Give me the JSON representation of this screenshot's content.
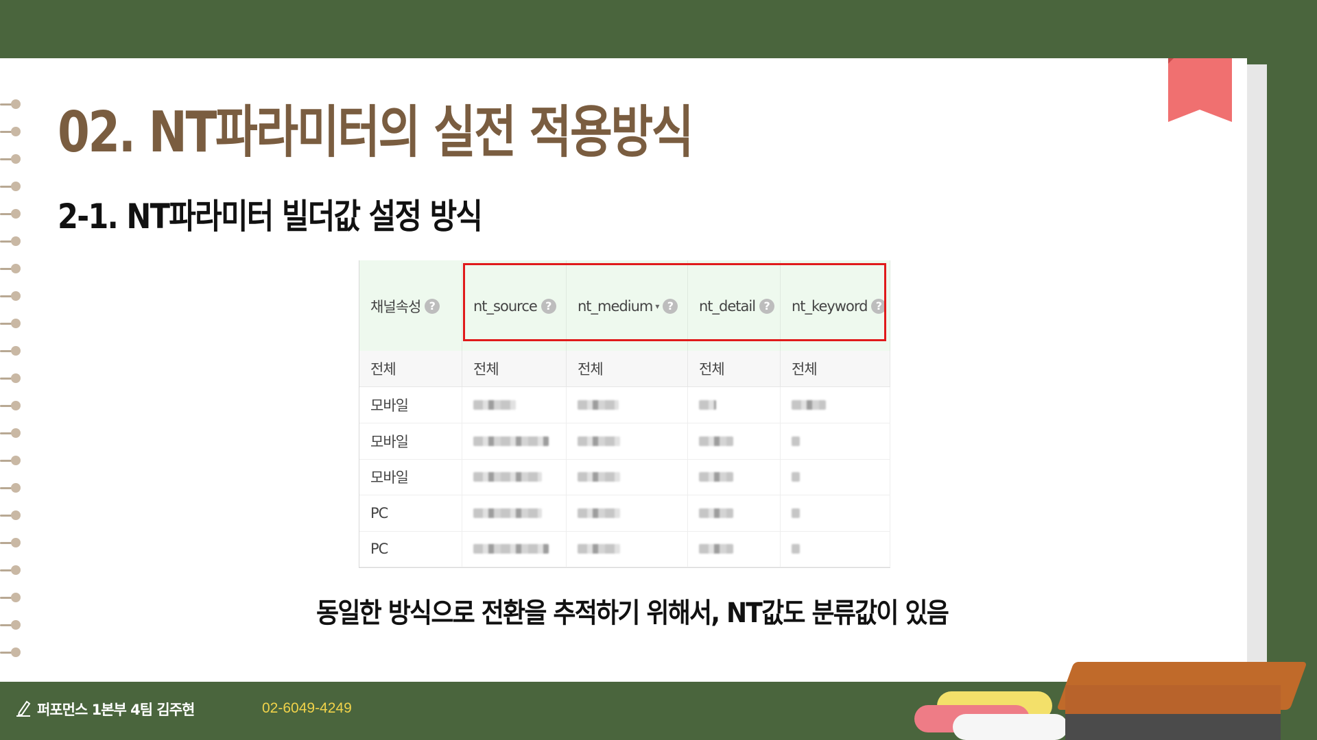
{
  "slide": {
    "title": "02. NT파라미터의 실전 적용방식",
    "subtitle": "2-1. NT파라미터 빌더값 설정 방식",
    "caption": "동일한 방식으로 전환을 추적하기 위해서, NT값도 분류값이 있음"
  },
  "table": {
    "headers": [
      "채널속성",
      "nt_source",
      "nt_medium",
      "nt_detail",
      "nt_keyword"
    ],
    "help_glyph": "?",
    "sort_glyph": "▾",
    "total_row": [
      "전체",
      "전체",
      "전체",
      "전체",
      "전체"
    ],
    "rows": [
      "모바일",
      "모바일",
      "모바일",
      "PC",
      "PC"
    ]
  },
  "footer": {
    "author": "퍼포먼스 1본부 4팀 김주현",
    "phone": "02-6049-4249"
  },
  "colors": {
    "background": "#4a653d",
    "title": "#7a5d40",
    "bookmark": "#f07070",
    "highlight_box": "#e01a1a",
    "phone": "#f1d34a"
  },
  "icons": [
    "pencil-icon",
    "help-icon",
    "sort-caret-icon",
    "bookmark-icon"
  ]
}
